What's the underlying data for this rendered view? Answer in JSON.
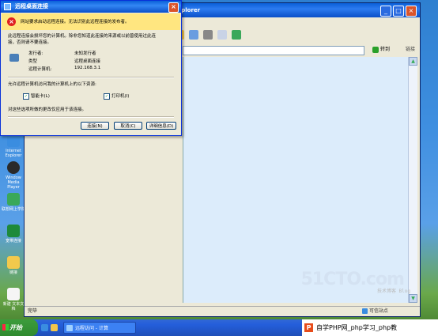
{
  "dialog": {
    "title": "远程桌面连接",
    "warning": "网站要求启动远程连接。无法识别此远程连接的发布者。",
    "intro_line1": "此远程连接会损坏您的计算机。除非您知道此连接的来源或以前曾使用过此连",
    "intro_line2": "接，否则请不要连接。",
    "publisher_label": "发行者:",
    "publisher_value": "未知发行者",
    "type_label": "类型",
    "type_value": "远程桌面连接",
    "remote_label": "远程计算机:",
    "remote_value": "192.168.3.1",
    "allow_text": "允许远程计算机访问我的计算机上的以下资源:",
    "smartcard_label": "智能卡(L)",
    "printer_label": "打印机(I)",
    "applies_text": "对这些选项所做的更改仅应用于该连接。",
    "connect_button": "连接(N)",
    "cancel_button": "取消(C)",
    "details_button": "详细信息(D)",
    "close_symbol": "×"
  },
  "browser": {
    "title": "rnet Explorer",
    "go_label": "转到",
    "links_label": "链接",
    "status_text": "完毕",
    "zone_text": "可信站点",
    "min_symbol": "_",
    "max_symbol": "□",
    "close_symbol": "×"
  },
  "desktop": {
    "icons": [
      {
        "label": "Internet Explorer"
      },
      {
        "label": "Window Media Player"
      },
      {
        "label": "联想网上学院"
      },
      {
        "label": "宽带连接"
      },
      {
        "label": "链接"
      },
      {
        "label": "新建 文本文档"
      }
    ]
  },
  "watermark": {
    "text": "51CTO.com",
    "sub": "技术博客 Blog"
  },
  "taskbar": {
    "start_label": "开始",
    "task_label": "远程访问 - 计算",
    "php_text": "自学PHP网_php学习_php教"
  },
  "colors": {
    "titlebar": "#0a5fd8",
    "warning_band": "#ffe680",
    "content_bg": "#dcecfb"
  }
}
